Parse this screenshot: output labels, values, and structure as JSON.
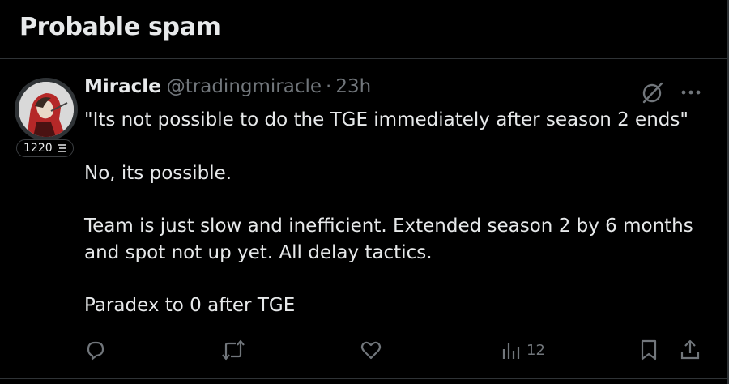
{
  "section": {
    "title": "Probable spam"
  },
  "tweet": {
    "author": {
      "name": "Miracle",
      "handle": "@tradingmiracle",
      "time": "23h",
      "badge_count": "1220"
    },
    "paragraphs": [
      "\"Its not possible to do the TGE immediately after season 2 ends\"",
      "No, its possible.",
      "Team is just slow and inefficient. Extended season 2 by 6 months and spot not up yet. All delay tactics.",
      "Paradex to 0 after TGE"
    ],
    "views": "12",
    "separator": "·"
  },
  "icons": {
    "grok": "slash-circle-icon",
    "more": "more-icon",
    "reply": "reply-icon",
    "repost": "repost-icon",
    "like": "like-icon",
    "views": "views-icon",
    "bookmark": "bookmark-icon",
    "share": "share-icon"
  },
  "colors": {
    "background": "#000000",
    "text": "#e7e9ea",
    "muted": "#71767b",
    "divider": "#2f3336"
  }
}
